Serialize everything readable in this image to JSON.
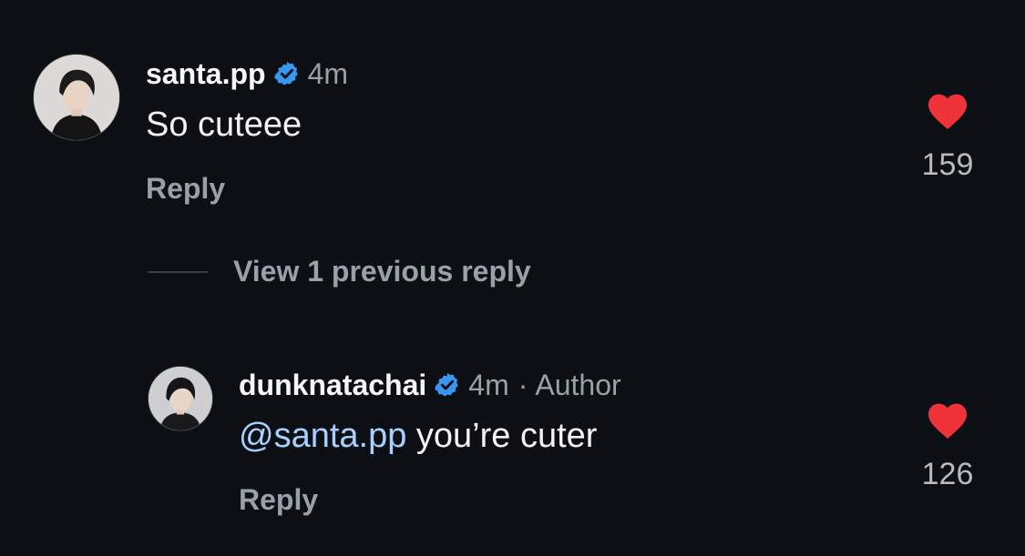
{
  "comments": [
    {
      "username": "santa.pp",
      "verified": true,
      "time": "4m",
      "text": "So cuteee",
      "reply_label": "Reply",
      "likes": "159",
      "liked": true
    },
    {
      "username": "dunknatachai",
      "verified": true,
      "time": "4m",
      "separator": "·",
      "role": "Author",
      "mention": "@santa.pp",
      "text": " you’re cuter",
      "reply_label": "Reply",
      "likes": "126",
      "liked": true
    }
  ],
  "thread": {
    "view_replies_label": "View 1 previous reply"
  },
  "icons": {
    "verified": "verified-badge-icon",
    "like": "heart-icon"
  },
  "colors": {
    "background": "#0c0f14",
    "verified": "#3897f0",
    "heart": "#f0323a",
    "mention": "#a8d0ff",
    "secondary_text": "#9aa0a8"
  }
}
